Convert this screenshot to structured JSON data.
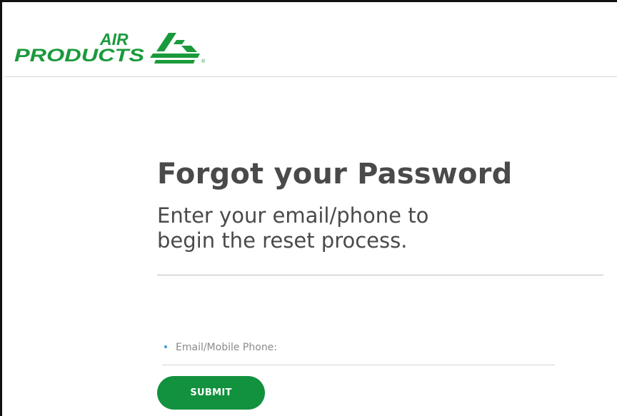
{
  "header": {
    "logo": {
      "name": "air-products-logo",
      "line1": "AIR",
      "line2": "PRODUCTS",
      "registered": "®",
      "color": "#1a9a3c"
    }
  },
  "main": {
    "title": "Forgot your Password",
    "subtitle_line1": "Enter your email/phone to",
    "subtitle_line2": "begin the reset process.",
    "form": {
      "email_label": "Email/Mobile Phone:",
      "email_value": "",
      "submit_label": "SUBMIT"
    }
  },
  "colors": {
    "brand_green": "#12913f",
    "title_text": "#4a4a4a",
    "bullet_blue": "#3aa0d8"
  }
}
